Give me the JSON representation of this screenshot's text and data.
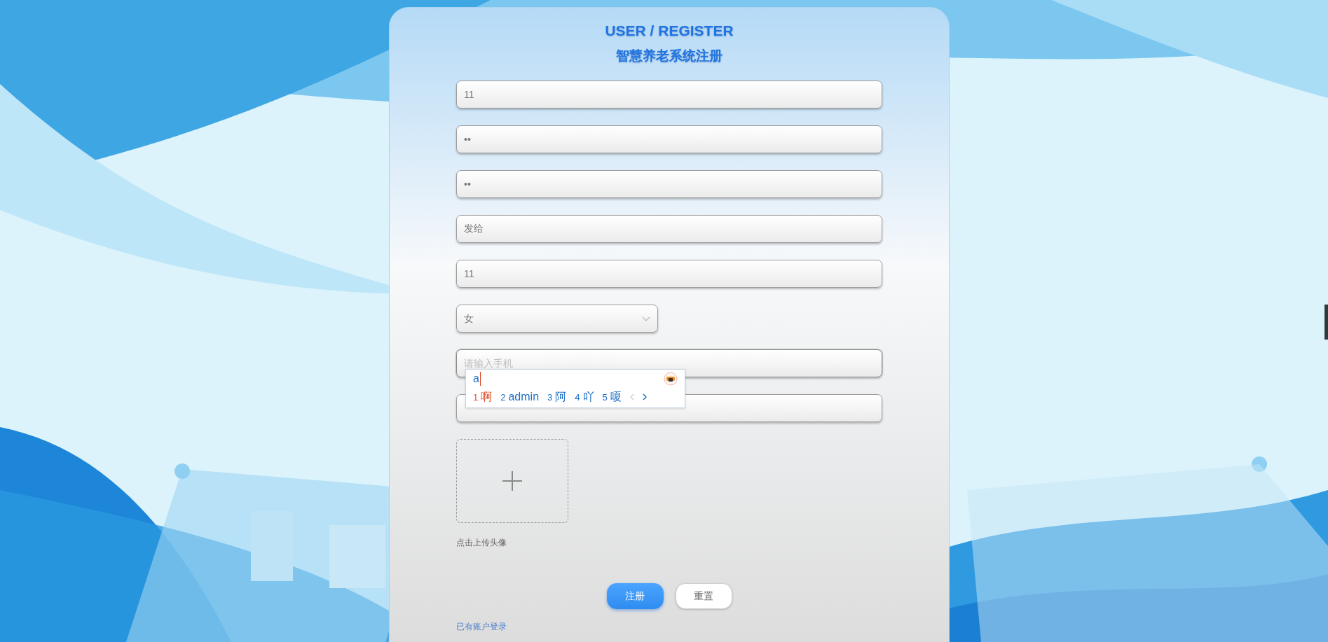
{
  "header": {
    "title": "USER / REGISTER",
    "subtitle": "智慧养老系统注册"
  },
  "fields": [
    {
      "kind": "text",
      "value": "11"
    },
    {
      "kind": "text",
      "value": "••"
    },
    {
      "kind": "text",
      "value": "••"
    },
    {
      "kind": "text",
      "value": "发给"
    },
    {
      "kind": "text",
      "value": "11"
    },
    {
      "kind": "select",
      "value": "女"
    },
    {
      "kind": "text",
      "placeholder": "请输入手机",
      "focused": true
    },
    {
      "kind": "text"
    }
  ],
  "upload": {
    "caption": "点击上传头像"
  },
  "buttons": [
    {
      "label": "注册",
      "kind": "primary"
    },
    {
      "label": "重置",
      "kind": "default"
    }
  ],
  "login_link": "已有账户登录",
  "ime": {
    "composition": "a",
    "prev_disabled": true,
    "candidates": [
      {
        "index": "1",
        "text": "啊",
        "selected": true
      },
      {
        "index": "2",
        "text": "admin",
        "selected": false
      },
      {
        "index": "3",
        "text": "阿",
        "selected": false
      },
      {
        "index": "4",
        "text": "吖",
        "selected": false
      },
      {
        "index": "5",
        "text": "嗄",
        "selected": false
      }
    ]
  }
}
